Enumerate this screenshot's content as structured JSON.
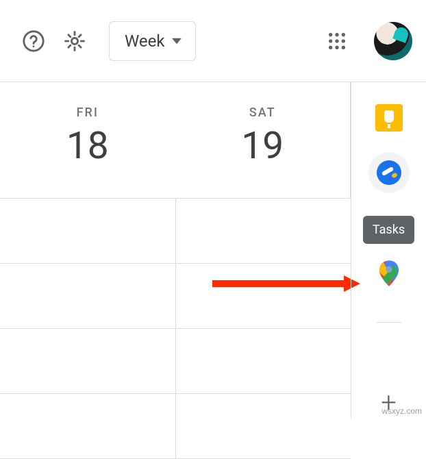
{
  "header": {
    "view_label": "Week"
  },
  "days": [
    {
      "dow": "FRI",
      "num": "18"
    },
    {
      "dow": "SAT",
      "num": "19"
    }
  ],
  "sidepanel": {
    "tooltip": "Tasks"
  },
  "watermark": "wsxyz.com"
}
